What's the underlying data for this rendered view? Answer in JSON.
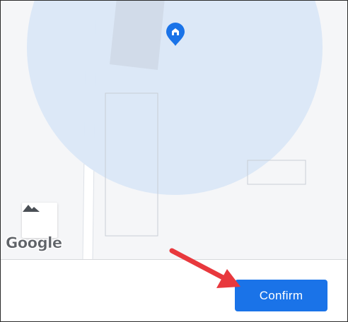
{
  "map": {
    "pin_icon": "home-pin-icon",
    "terrain_icon": "terrain-mountains-icon",
    "attribution": "Google",
    "colors": {
      "accuracy_circle": "#dbe7f7",
      "pin": "#1a73e8"
    }
  },
  "footer": {
    "confirm_label": "Confirm",
    "confirm_color": "#1a73e8"
  },
  "annotation": {
    "arrow_icon": "red-arrow-icon",
    "color": "#e8383d"
  }
}
